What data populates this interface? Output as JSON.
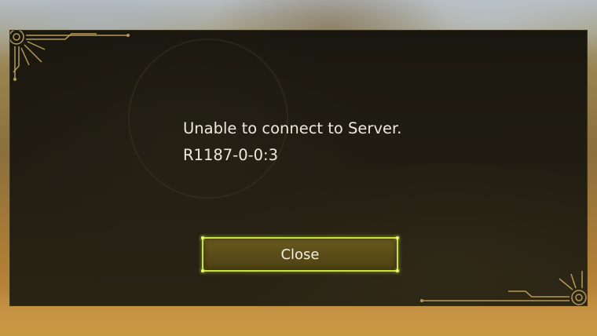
{
  "dialog": {
    "message_line1": "Unable to connect to Server.",
    "message_line2": "R1187-0-0:3",
    "close_label": "Close"
  },
  "colors": {
    "accent": "#c7e33a",
    "frame_gold": "#b59a55",
    "panel": "#1f1b12",
    "text": "#ece8dd"
  },
  "icons": {
    "top_left": "ornamental-corner-icon",
    "bottom_right": "ornamental-corner-icon"
  }
}
